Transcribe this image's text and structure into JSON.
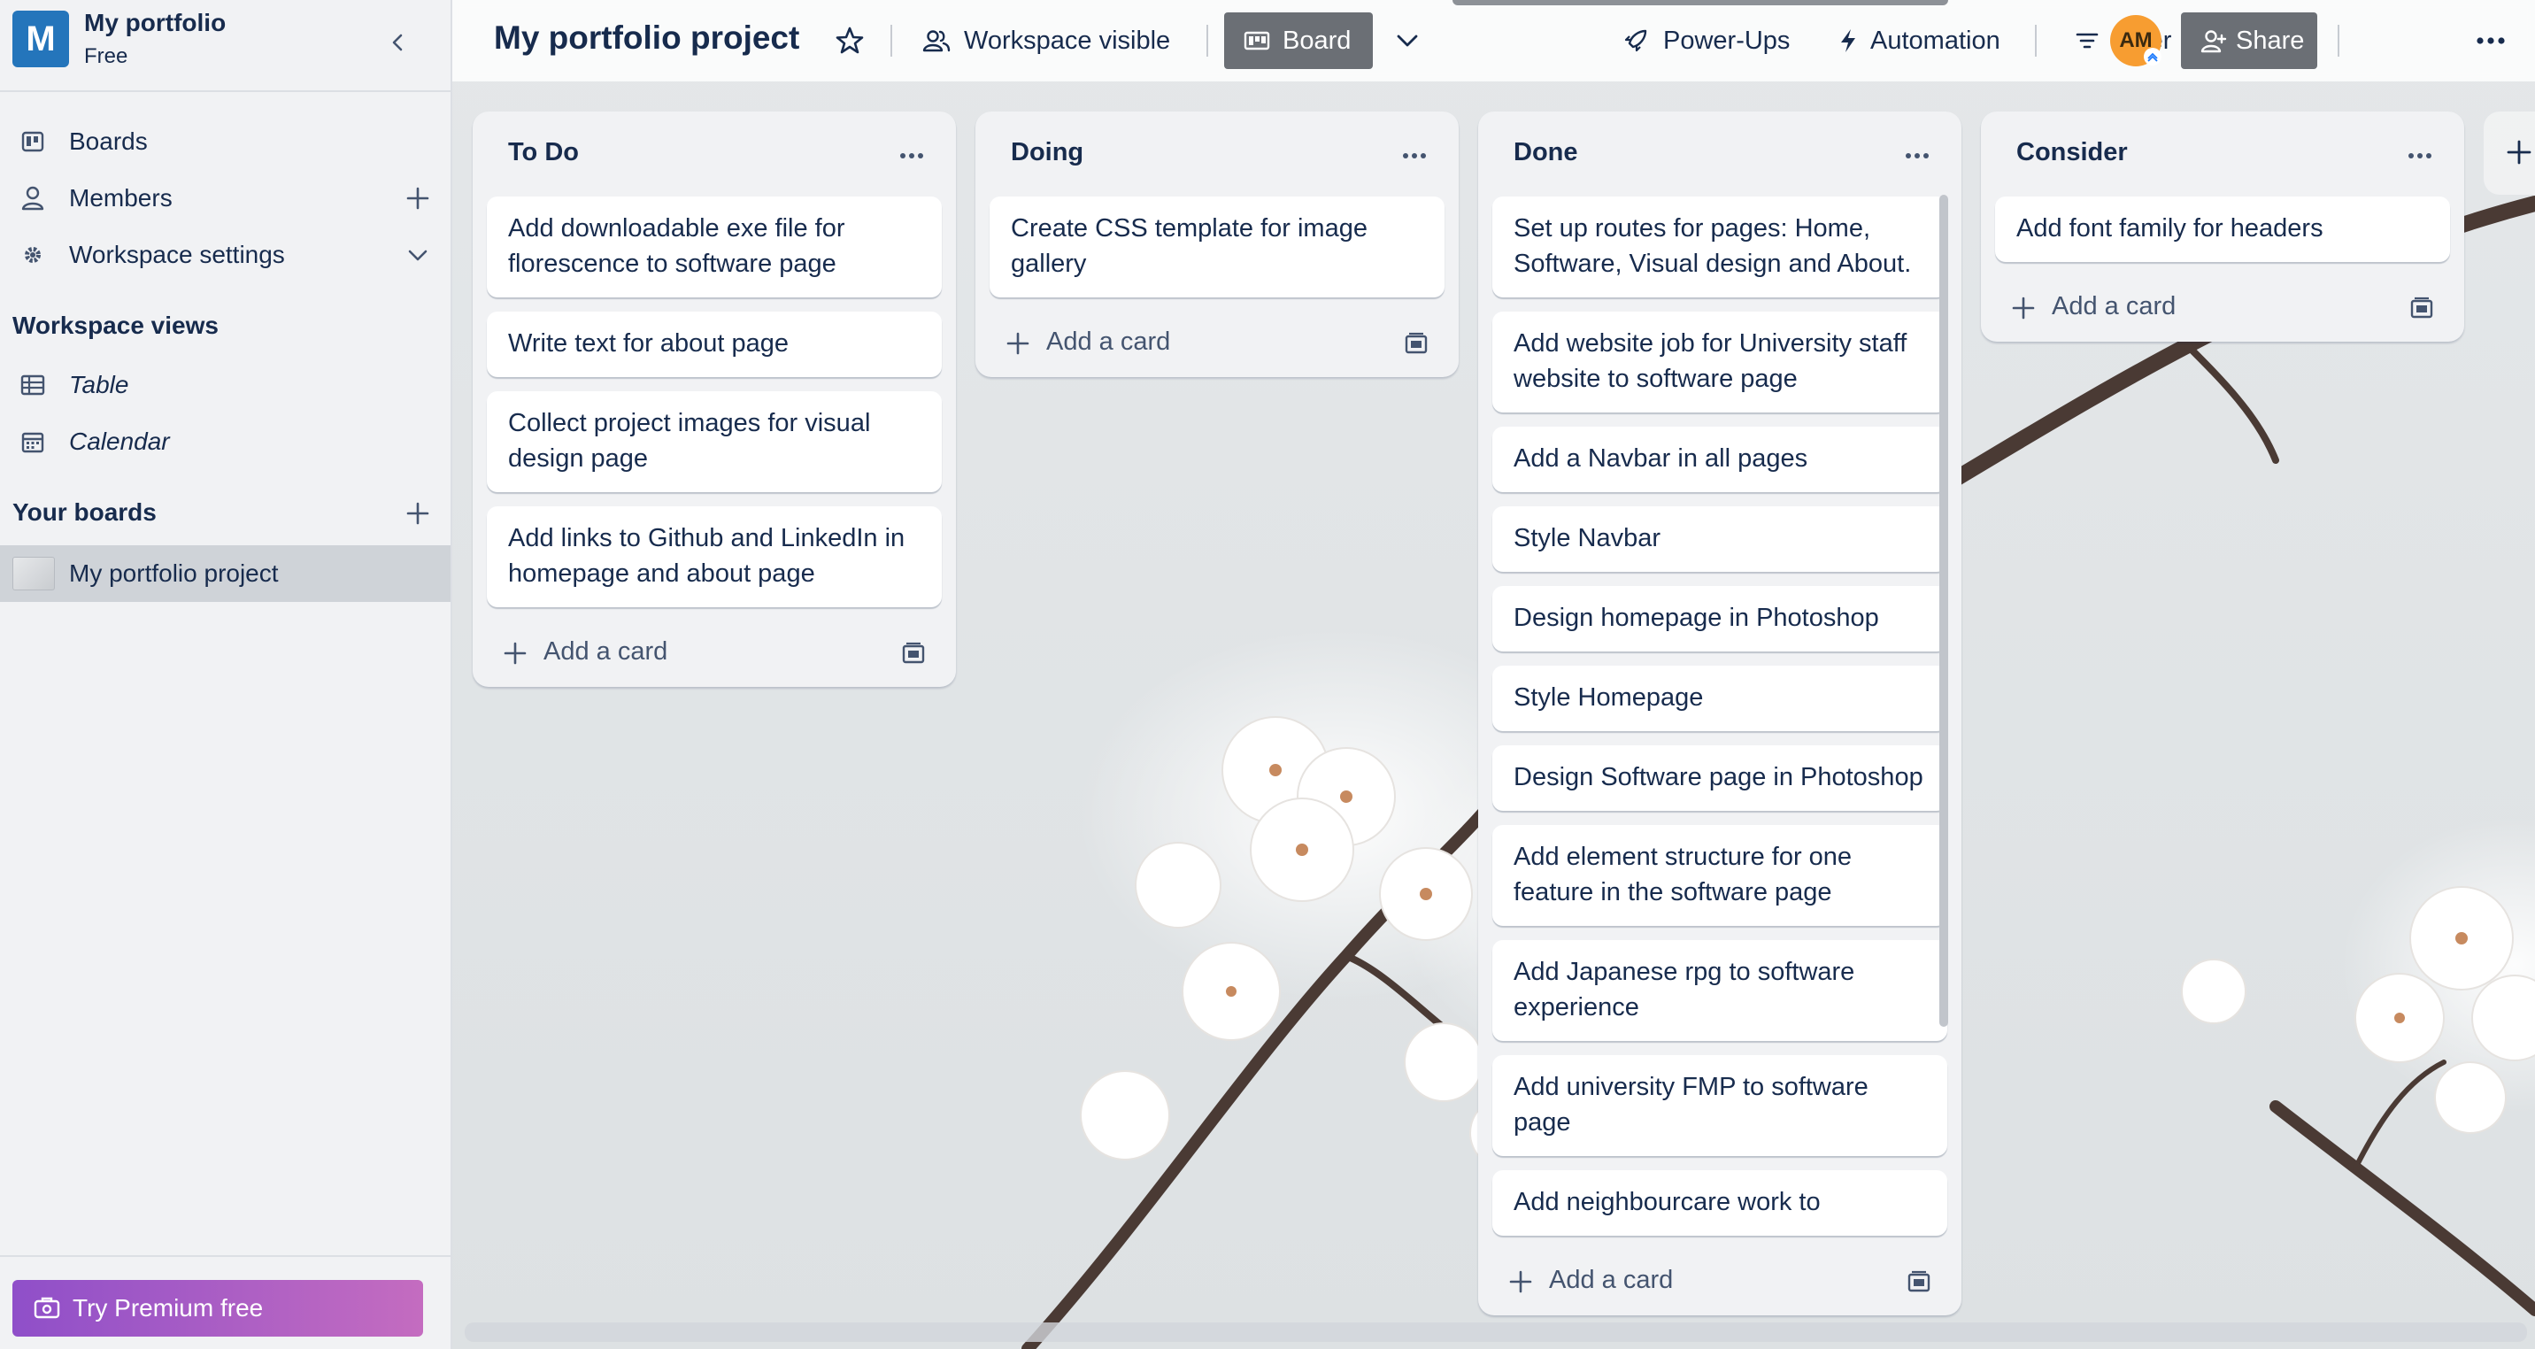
{
  "workspace": {
    "logo_letter": "M",
    "name": "My portfolio",
    "plan": "Free"
  },
  "sidebar": {
    "items": [
      {
        "label": "Boards",
        "icon": "board-icon"
      },
      {
        "label": "Members",
        "icon": "person-icon"
      },
      {
        "label": "Workspace settings",
        "icon": "gear-icon"
      }
    ],
    "views_title": "Workspace views",
    "views": [
      {
        "label": "Table",
        "icon": "table-icon"
      },
      {
        "label": "Calendar",
        "icon": "calendar-icon"
      }
    ],
    "boards_title": "Your boards",
    "boards": [
      {
        "label": "My portfolio project"
      }
    ],
    "premium_label": "Try Premium free"
  },
  "toolbar": {
    "board_title": "My portfolio project",
    "visibility_label": "Workspace visible",
    "view_label": "Board",
    "powerups_label": "Power-Ups",
    "automation_label": "Automation",
    "filter_label": "Filter",
    "avatar_initials": "AM",
    "share_label": "Share"
  },
  "lists": [
    {
      "title": "To Do",
      "cards": [
        "Add downloadable exe file for florescence to software page",
        "Write text for about page",
        "Collect project images for visual design page",
        "Add links to Github and LinkedIn in homepage and about page"
      ],
      "add_label": "Add a card"
    },
    {
      "title": "Doing",
      "cards": [
        "Create CSS template for image gallery"
      ],
      "add_label": "Add a card"
    },
    {
      "title": "Done",
      "cards": [
        "Set up routes for pages: Home, Software, Visual design and About.",
        "Add website job for University staff website to software page",
        "Add a Navbar in all pages",
        "Style Navbar",
        "Design homepage in Photoshop",
        "Style Homepage",
        "Design Software page in Photoshop",
        "Add element structure for one feature in the software page",
        "Add Japanese rpg to software experience",
        "Add university FMP to software page",
        "Add neighbourcare work to"
      ],
      "add_label": "Add a card"
    },
    {
      "title": "Consider",
      "cards": [
        "Add font family for headers"
      ],
      "add_label": "Add a card"
    }
  ],
  "colors": {
    "brand": "#2475bb",
    "avatar": "#f79d31",
    "premium_start": "#8f4fc9",
    "premium_end": "#c46cc0",
    "toolbar_button": "#6b6f75"
  }
}
